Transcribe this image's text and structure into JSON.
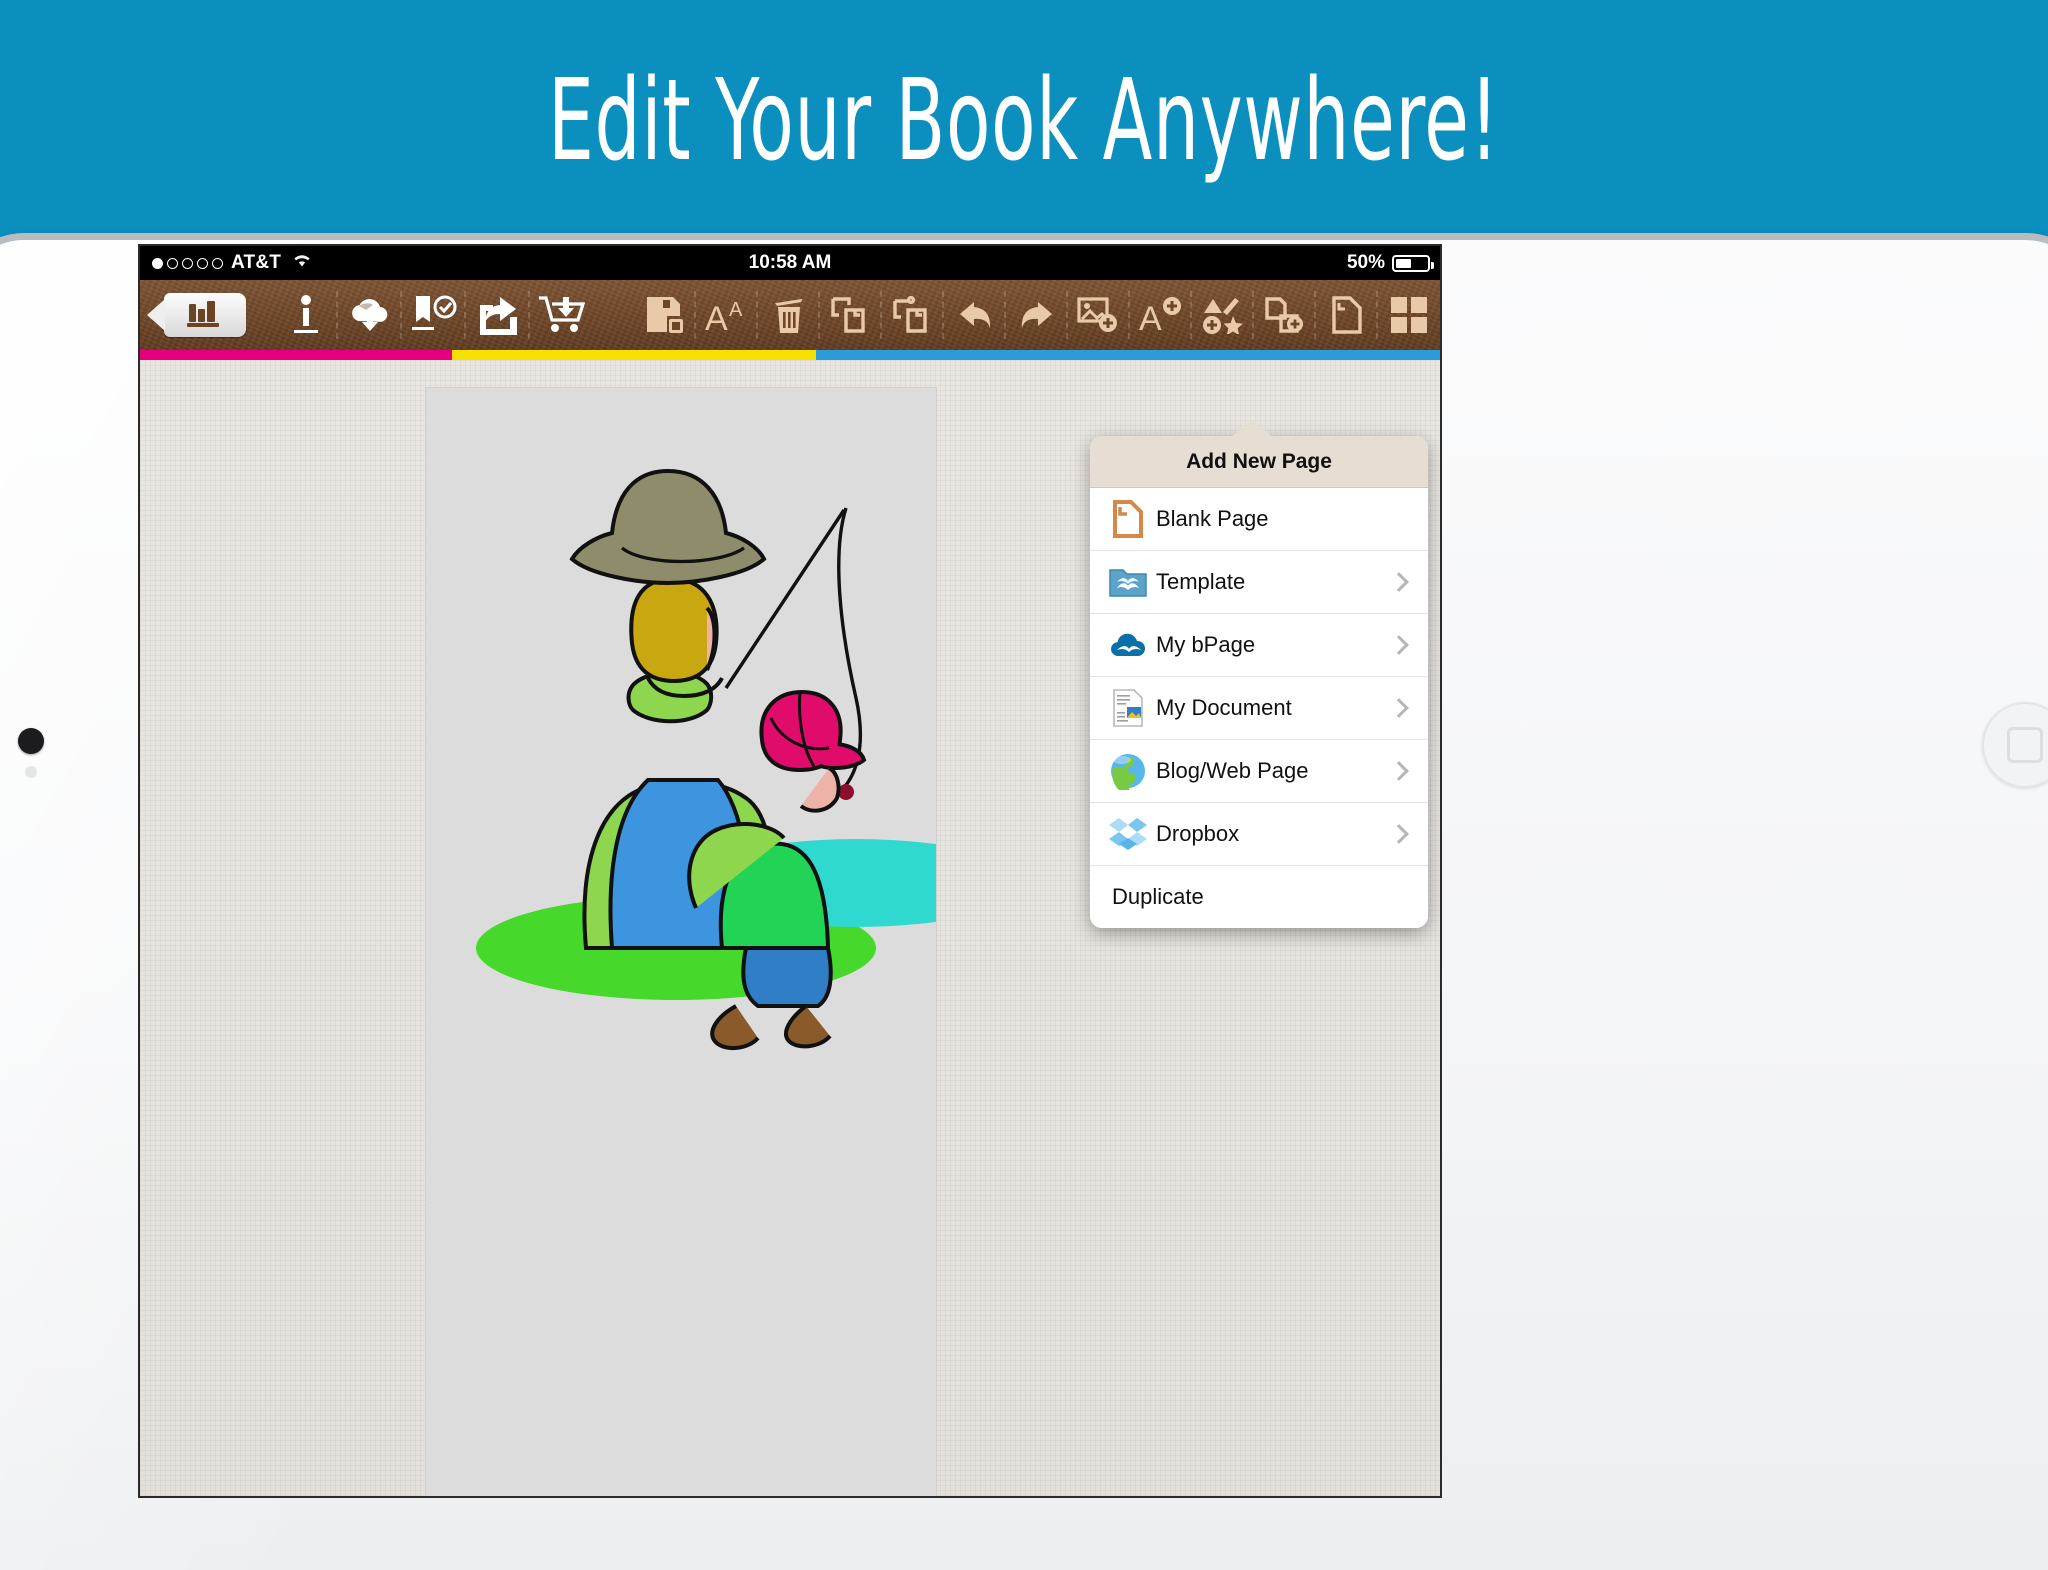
{
  "banner": {
    "title": "Edit Your Book Anywhere!",
    "bg_color": "#0b8fbe"
  },
  "device": {
    "type": "tablet",
    "home_button": "home-button",
    "camera": "front-camera"
  },
  "status_bar": {
    "signal_dots_total": 5,
    "signal_dots_filled": 1,
    "carrier": "AT&T",
    "wifi": "wifi-icon",
    "time": "10:58 AM",
    "battery_percent": "50%",
    "battery_level": 50
  },
  "toolbar": {
    "left": [
      {
        "name": "library-button",
        "label": "Library",
        "icon": "books-icon"
      },
      {
        "name": "info-button",
        "label": "Info",
        "icon": "info-i-icon"
      },
      {
        "name": "cloud-upload-button",
        "label": "Cloud Upload",
        "icon": "cloud-upload-icon"
      },
      {
        "name": "publish-button",
        "label": "Publish",
        "icon": "book-check-icon"
      },
      {
        "name": "share-button",
        "label": "Share",
        "icon": "share-arrow-icon"
      },
      {
        "name": "store-button",
        "label": "Store",
        "icon": "shopping-cart-icon"
      }
    ],
    "right": [
      {
        "name": "save-button",
        "label": "Save",
        "icon": "floppy-disk-icon"
      },
      {
        "name": "font-size-button",
        "label": "Font Size",
        "icon": "text-size-aa-icon"
      },
      {
        "name": "delete-button",
        "label": "Delete",
        "icon": "trash-can-icon"
      },
      {
        "name": "copy-button",
        "label": "Copy",
        "icon": "copy-icon"
      },
      {
        "name": "paste-button",
        "label": "Paste",
        "icon": "paste-icon"
      },
      {
        "name": "undo-button",
        "label": "Undo",
        "icon": "undo-arrow-icon"
      },
      {
        "name": "redo-button",
        "label": "Redo",
        "icon": "redo-arrow-icon"
      },
      {
        "name": "add-image-button",
        "label": "Add Image",
        "icon": "image-plus-icon"
      },
      {
        "name": "add-text-button",
        "label": "Add Text",
        "icon": "text-plus-icon"
      },
      {
        "name": "add-shape-button",
        "label": "Add Shape",
        "icon": "shapes-plus-icon"
      },
      {
        "name": "add-page-button",
        "label": "Add Page",
        "icon": "page-plus-icon"
      },
      {
        "name": "page-button",
        "label": "Page",
        "icon": "page-icon"
      },
      {
        "name": "grid-button",
        "label": "Grid",
        "icon": "grid-icon"
      }
    ],
    "strip_colors": [
      "#e5007d",
      "#f5e000",
      "#2e9bd6"
    ]
  },
  "popup": {
    "title": "Add New Page",
    "items": [
      {
        "label": "Blank Page",
        "icon": "blank-page-icon",
        "chevron": false
      },
      {
        "label": "Template",
        "icon": "template-folder-icon",
        "chevron": true
      },
      {
        "label": "My bPage",
        "icon": "bpage-cloud-icon",
        "chevron": true
      },
      {
        "label": "My Document",
        "icon": "document-icon",
        "chevron": true
      },
      {
        "label": "Blog/Web Page",
        "icon": "globe-icon",
        "chevron": true
      },
      {
        "label": "Dropbox",
        "icon": "dropbox-icon",
        "chevron": true
      },
      {
        "label": "Duplicate",
        "icon": "",
        "chevron": false
      }
    ]
  },
  "canvas": {
    "illustration": "man-and-boy-fishing",
    "colors": {
      "hat": "#8e8c6a",
      "shirt": "#8ed64e",
      "overalls": "#3d95e0",
      "boy_shirt": "#22d455",
      "boy_pants": "#2f7ec6",
      "cap": "#e00b6a",
      "grass": "#46d82a",
      "water": "#2fd9cf",
      "skin": "#eeb3a8",
      "hair": "#c8a710"
    }
  }
}
